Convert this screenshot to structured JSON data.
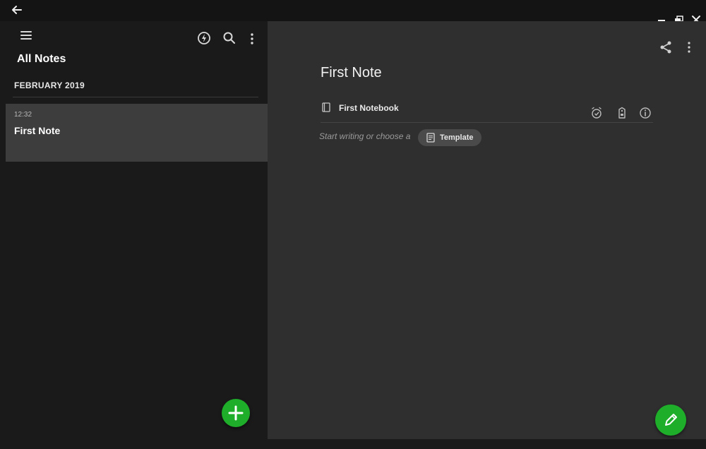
{
  "titlebar": {
    "icons": [
      "back-arrow-icon",
      "minimize-icon",
      "restore-icon",
      "close-icon"
    ]
  },
  "left_pane": {
    "toolbar_icons": [
      "hamburger-menu-icon",
      "sync-icon",
      "search-icon",
      "more-vertical-icon"
    ],
    "title": "All Notes",
    "section_header": "FEBRUARY 2019",
    "notes": [
      {
        "time": "12:32",
        "title": "First Note"
      }
    ],
    "fab_icon": "plus-icon"
  },
  "editor": {
    "toolbar_icons": [
      "share-icon",
      "more-vertical-icon"
    ],
    "note_title": "First Note",
    "notebook": "First Notebook",
    "meta_icons": [
      "reminder-alarm-icon",
      "tag-icon",
      "info-icon"
    ],
    "prompt": "Start writing or choose a",
    "template_button": "Template",
    "fab_icon": "pencil-icon"
  },
  "colors": {
    "accent": "#1fae2a",
    "sidebar_bg": "#1a1a1a",
    "editor_bg": "#2f2f2f",
    "selected_row": "#3d3d3d"
  }
}
